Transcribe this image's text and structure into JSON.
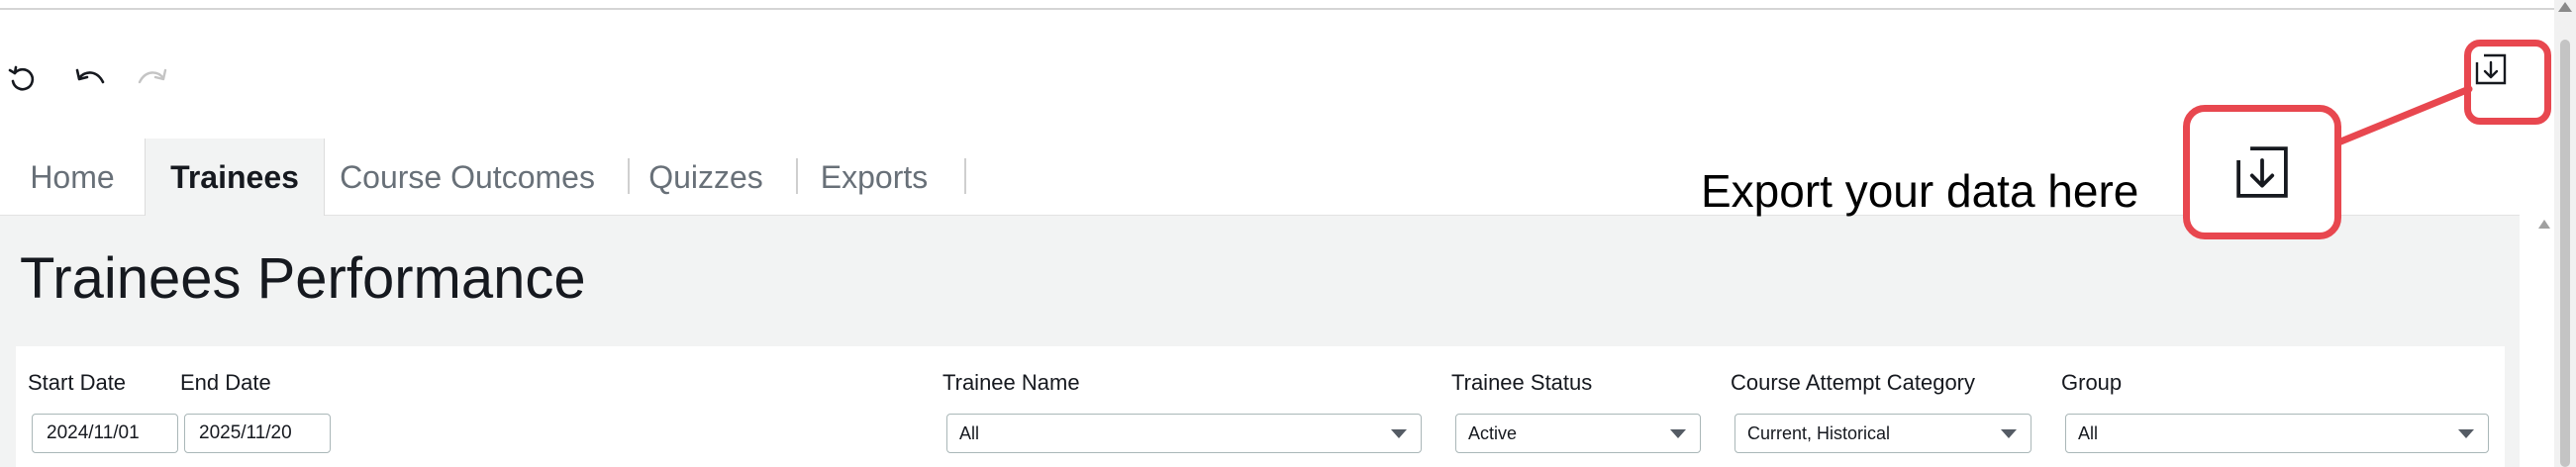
{
  "toolbar": {
    "refresh_icon": "refresh-icon",
    "undo_icon": "undo-icon",
    "redo_icon": "redo-icon",
    "export_icon": "export-download-icon"
  },
  "tabs": [
    {
      "label": "Home",
      "active": false
    },
    {
      "label": "Trainees",
      "active": true
    },
    {
      "label": "Course Outcomes",
      "active": false
    },
    {
      "label": "Quizzes",
      "active": false
    },
    {
      "label": "Exports",
      "active": false
    }
  ],
  "page": {
    "title": "Trainees Performance"
  },
  "filters": {
    "start_date": {
      "label": "Start Date",
      "value": "2024/11/01"
    },
    "end_date": {
      "label": "End Date",
      "value": "2025/11/20"
    },
    "trainee_name": {
      "label": "Trainee Name",
      "value": "All"
    },
    "trainee_status": {
      "label": "Trainee Status",
      "value": "Active"
    },
    "course_attempt_category": {
      "label": "Course Attempt Category",
      "value": "Current, Historical"
    },
    "group": {
      "label": "Group",
      "value": "All"
    }
  },
  "callout": {
    "text": "Export your data here",
    "color": "#e8474f"
  }
}
